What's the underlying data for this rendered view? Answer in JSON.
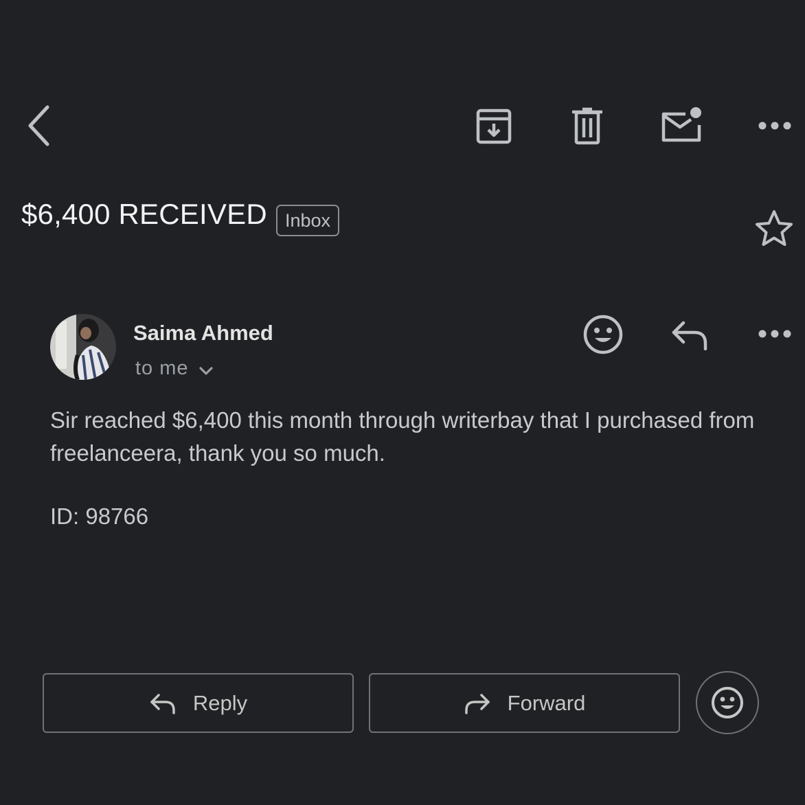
{
  "toolbar": {
    "back_icon": "chevron-left-icon",
    "archive_icon": "archive-icon",
    "delete_icon": "trash-icon",
    "mark_unread_icon": "mail-unread-icon",
    "more_icon": "more-horizontal-icon"
  },
  "email": {
    "subject": "$6,400 RECEIVED",
    "label": "Inbox",
    "starred": false,
    "sender": {
      "name": "Saima Ahmed",
      "recipients": "to me"
    },
    "body": "Sir reached $6,400 this month through writerbay that I purchased from freelanceera, thank you so much.",
    "id_line": "ID: 98766"
  },
  "actions": {
    "reply_label": "Reply",
    "forward_label": "Forward"
  },
  "colors": {
    "background": "#202124",
    "text_primary": "#e8eaed",
    "text_secondary": "#9aa0a6",
    "icon": "#bdc1c6",
    "border": "#6f7276"
  }
}
